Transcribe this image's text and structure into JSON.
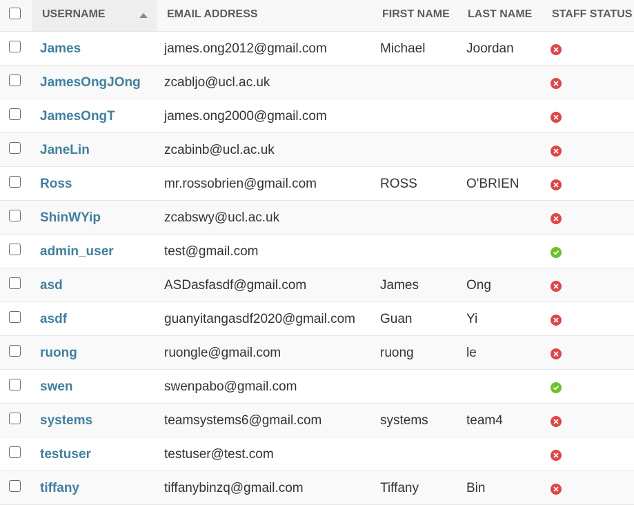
{
  "header": {
    "username": "USERNAME",
    "email": "EMAIL ADDRESS",
    "first_name": "FIRST NAME",
    "last_name": "LAST NAME",
    "staff_status": "STAFF STATUS"
  },
  "rows": [
    {
      "username": "James",
      "email": "james.ong2012@gmail.com",
      "first": "Michael",
      "last": "Joordan",
      "staff": false
    },
    {
      "username": "JamesOngJOng",
      "email": "zcabljo@ucl.ac.uk",
      "first": "",
      "last": "",
      "staff": false
    },
    {
      "username": "JamesOngT",
      "email": "james.ong2000@gmail.com",
      "first": "",
      "last": "",
      "staff": false
    },
    {
      "username": "JaneLin",
      "email": "zcabinb@ucl.ac.uk",
      "first": "",
      "last": "",
      "staff": false
    },
    {
      "username": "Ross",
      "email": "mr.rossobrien@gmail.com",
      "first": "ROSS",
      "last": "O'BRIEN",
      "staff": false
    },
    {
      "username": "ShinWYip",
      "email": "zcabswy@ucl.ac.uk",
      "first": "",
      "last": "",
      "staff": false
    },
    {
      "username": "admin_user",
      "email": "test@gmail.com",
      "first": "",
      "last": "",
      "staff": true
    },
    {
      "username": "asd",
      "email": "ASDasfasdf@gmail.com",
      "first": "James",
      "last": "Ong",
      "staff": false
    },
    {
      "username": "asdf",
      "email": "guanyitangasdf2020@gmail.com",
      "first": "Guan",
      "last": "Yi",
      "staff": false
    },
    {
      "username": "ruong",
      "email": "ruongle@gmail.com",
      "first": "ruong",
      "last": "le",
      "staff": false
    },
    {
      "username": "swen",
      "email": "swenpabo@gmail.com",
      "first": "",
      "last": "",
      "staff": true
    },
    {
      "username": "systems",
      "email": "teamsystems6@gmail.com",
      "first": "systems",
      "last": "team4",
      "staff": false
    },
    {
      "username": "testuser",
      "email": "testuser@test.com",
      "first": "",
      "last": "",
      "staff": false
    },
    {
      "username": "tiffany",
      "email": "tiffanybinzq@gmail.com",
      "first": "Tiffany",
      "last": "Bin",
      "staff": false
    }
  ],
  "colors": {
    "link": "#41809f",
    "false_icon": "#dd4646",
    "true_icon": "#70bf2b"
  },
  "icons": {
    "staff_false": "x-circle-icon",
    "staff_true": "check-circle-icon"
  }
}
